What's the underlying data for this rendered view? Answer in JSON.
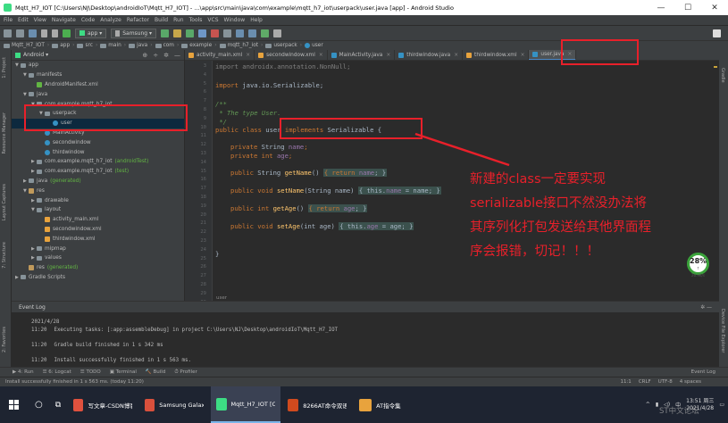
{
  "window": {
    "title": "Mqtt_H7_IOT [C:\\Users\\NJ\\Desktop\\androidIoT\\Mqtt_H7_IOT] - ...\\app\\src\\main\\java\\com\\example\\mqtt_h7_iot\\userpack\\user.java [app] - Android Studio",
    "minimize": "—",
    "maximize": "☐",
    "close": "✕"
  },
  "menu": [
    "File",
    "Edit",
    "View",
    "Navigate",
    "Code",
    "Analyze",
    "Refactor",
    "Build",
    "Run",
    "Tools",
    "VCS",
    "Window",
    "Help"
  ],
  "toolbar": {
    "module_combo": "app ▾",
    "device_combo": "Samsung ▾"
  },
  "breadcrumbs": [
    "Mqtt_H7_IOT",
    "app",
    "src",
    "main",
    "java",
    "com",
    "example",
    "mqtt_h7_iot",
    "userpack",
    "user"
  ],
  "project_panel": {
    "view_selector": "Android ▾",
    "tree": [
      {
        "label": "app",
        "depth": 0,
        "icon": "folder",
        "arrow": "▼"
      },
      {
        "label": "manifests",
        "depth": 1,
        "icon": "folder",
        "arrow": "▼"
      },
      {
        "label": "AndroidManifest.xml",
        "depth": 2,
        "icon": "manifest",
        "arrow": ""
      },
      {
        "label": "java",
        "depth": 1,
        "icon": "folder",
        "arrow": "▼"
      },
      {
        "label": "com.example.mqtt_h7_iot",
        "depth": 2,
        "icon": "folder",
        "arrow": "▼"
      },
      {
        "label": "userpack",
        "depth": 3,
        "icon": "folder",
        "arrow": "▼"
      },
      {
        "label": "user",
        "depth": 4,
        "icon": "java",
        "arrow": ""
      },
      {
        "label": "MainActivity",
        "depth": 3,
        "icon": "java",
        "arrow": ""
      },
      {
        "label": "secondwindow",
        "depth": 3,
        "icon": "java",
        "arrow": ""
      },
      {
        "label": "thirdwindow",
        "depth": 3,
        "icon": "java",
        "arrow": ""
      },
      {
        "label": "com.example.mqtt_h7_iot",
        "depth": 2,
        "icon": "folder",
        "arrow": "▶",
        "suffix": "(androidTest)"
      },
      {
        "label": "com.example.mqtt_h7_iot",
        "depth": 2,
        "icon": "folder",
        "arrow": "▶",
        "suffix": "(test)"
      },
      {
        "label": "java",
        "depth": 1,
        "icon": "folder",
        "arrow": "▶",
        "suffix": "(generated)"
      },
      {
        "label": "res",
        "depth": 1,
        "icon": "res",
        "arrow": "▼"
      },
      {
        "label": "drawable",
        "depth": 2,
        "icon": "folder",
        "arrow": "▶"
      },
      {
        "label": "layout",
        "depth": 2,
        "icon": "folder",
        "arrow": "▼"
      },
      {
        "label": "activity_main.xml",
        "depth": 3,
        "icon": "xml",
        "arrow": ""
      },
      {
        "label": "secondwindow.xml",
        "depth": 3,
        "icon": "xml",
        "arrow": ""
      },
      {
        "label": "thirdwindow.xml",
        "depth": 3,
        "icon": "xml",
        "arrow": ""
      },
      {
        "label": "mipmap",
        "depth": 2,
        "icon": "folder",
        "arrow": "▶"
      },
      {
        "label": "values",
        "depth": 2,
        "icon": "folder",
        "arrow": "▶"
      },
      {
        "label": "res",
        "depth": 1,
        "icon": "res",
        "arrow": "",
        "suffix": "(generated)"
      },
      {
        "label": "Gradle Scripts",
        "depth": 0,
        "icon": "folder",
        "arrow": "▶"
      }
    ]
  },
  "tabs": [
    {
      "label": "activity_main.xml",
      "icon": "xml",
      "active": false
    },
    {
      "label": "secondwindow.xml",
      "icon": "xml",
      "active": false
    },
    {
      "label": "MainActivity.java",
      "icon": "java",
      "active": false
    },
    {
      "label": "thirdwindow.java",
      "icon": "java",
      "active": false
    },
    {
      "label": "thirdwindow.xml",
      "icon": "xml",
      "active": false
    },
    {
      "label": "user.java",
      "icon": "java",
      "active": true
    }
  ],
  "line_numbers": [
    "3",
    "4",
    "5",
    "6",
    "7",
    "8",
    "9",
    "10",
    "11",
    "12",
    "13",
    "14",
    "15",
    "16",
    "17",
    "18",
    "19",
    "20",
    "21",
    "22",
    "23",
    "24",
    "25",
    "26",
    "27",
    "28",
    "29",
    "30",
    "31",
    "32"
  ],
  "code": {
    "l3": "import androidx.annotation.NonNull;",
    "l5a": "import",
    "l5b": " java.io.Serializable;",
    "l7": "/**",
    "l8": " * The type User.",
    "l9": " */",
    "l10a": "public class ",
    "l10b": "user ",
    "l10c": "implements",
    "l10d": " Serializable {",
    "l12a": "private ",
    "l12b": "String ",
    "l12c": "name",
    "l12d": ";",
    "l13a": "private int ",
    "l13b": "age",
    "l13c": ";",
    "l15a": "public ",
    "l15b": "String ",
    "l15c": "getName",
    "l15d": "() ",
    "l15e": "{ return ",
    "l15f": "name",
    "l15g": "; }",
    "l17a": "public void ",
    "l17b": "setName",
    "l17c": "(String name) ",
    "l17d": "{ this.",
    "l17e": "name",
    "l17f": " = name; }",
    "l19a": "public int ",
    "l19b": "getAge",
    "l19c": "() ",
    "l19d": "{ return ",
    "l19e": "age",
    "l19f": "; }",
    "l21a": "public void ",
    "l21b": "setAge",
    "l21c": "(int age) ",
    "l21d": "{ this.",
    "l21e": "age",
    "l21f": " = age; }",
    "l23": "}"
  },
  "editor_footer": "user",
  "event_log": {
    "title": "Event Log",
    "date": "2021/4/28",
    "entries": [
      {
        "time": "11:20",
        "text": "Executing tasks: [:app:assembleDebug] in project C:\\Users\\NJ\\Desktop\\androidIoT\\Mqtt_H7_IOT"
      },
      {
        "time": "11:20",
        "text": "Gradle build finished in 1 s 342 ms"
      },
      {
        "time": "11:20",
        "text": "Install successfully finished in 1 s 563 ms."
      }
    ]
  },
  "bottom_tabs": [
    "▶ 4: Run",
    "☰ 6: Logcat",
    "☰ TODO",
    "▣ Terminal",
    "🔨 Build",
    "⏱ Profiler",
    "Event Log"
  ],
  "status": {
    "message": "Install successfully finished in 1 s 563 ms. (today 11:20)",
    "position": "11:1",
    "line_sep": "CRLF",
    "encoding": "UTF-8",
    "indent": "4 spaces"
  },
  "annotation": {
    "lines": [
      "新建的class一定要实现",
      "serializable接口不然没办法将",
      "其序列化打包发送给其他界面程",
      "序会报错，切记！！！"
    ],
    "color": "#e8202a"
  },
  "badge": {
    "value": "28%",
    "sub": "↑ 26.9K/s"
  },
  "taskbar": {
    "items": [
      {
        "label": "写文章-CSDN博客 ...",
        "color": "#e0513e"
      },
      {
        "label": "Samsung Galaxy ...",
        "color": "#d9503c"
      },
      {
        "label": "Mqtt_H7_IOT [C:\\...",
        "color": "#3ddc84",
        "active": true
      },
      {
        "label": "8266AT命令双语...",
        "color": "#d04a1e"
      },
      {
        "label": "AT指令集",
        "color": "#e8a33d"
      }
    ],
    "time": "13:51 周三",
    "date": "2021/4/28",
    "ime": "中"
  },
  "watermark": "ST中文论坛"
}
